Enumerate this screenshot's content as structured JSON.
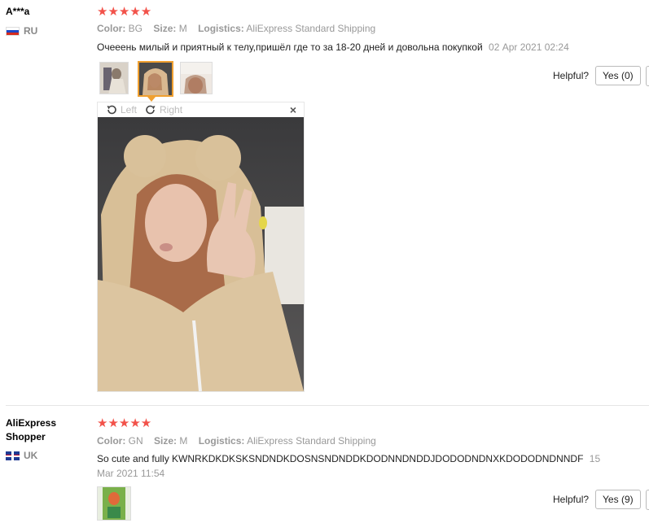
{
  "reviews": [
    {
      "user": "A***a",
      "country": "RU",
      "stars": "★★★★★",
      "color_label": "Color:",
      "color_value": "BG",
      "size_label": "Size:",
      "size_value": "M",
      "logistics_label": "Logistics:",
      "logistics_value": "AliExpress Standard Shipping",
      "comment": "Очееень милый и приятный к телу,пришёл где то за 18-20 дней и довольна покупкой",
      "date": "02 Apr 2021 02:24",
      "helpful_label": "Helpful?",
      "yes_label": "Yes (0)"
    },
    {
      "user": "AliExpress Shopper",
      "country": "UK",
      "stars": "★★★★★",
      "color_label": "Color:",
      "color_value": "GN",
      "size_label": "Size:",
      "size_value": "M",
      "logistics_label": "Logistics:",
      "logistics_value": "AliExpress Standard Shipping",
      "comment": "So cute and fully KWNRKDKDKSKSNDNDKDOSNSNDNDDKDODNNDNDDJDODODNDNXKDODODNDNNDF",
      "date": "15 Mar 2021 11:54",
      "helpful_label": "Helpful?",
      "yes_label": "Yes (9)"
    }
  ],
  "viewer": {
    "left_label": "Left",
    "right_label": "Right",
    "close": "×"
  },
  "colors": {
    "star": "#f2524a",
    "muted": "#999999",
    "active_thumb": "#f0a030"
  }
}
